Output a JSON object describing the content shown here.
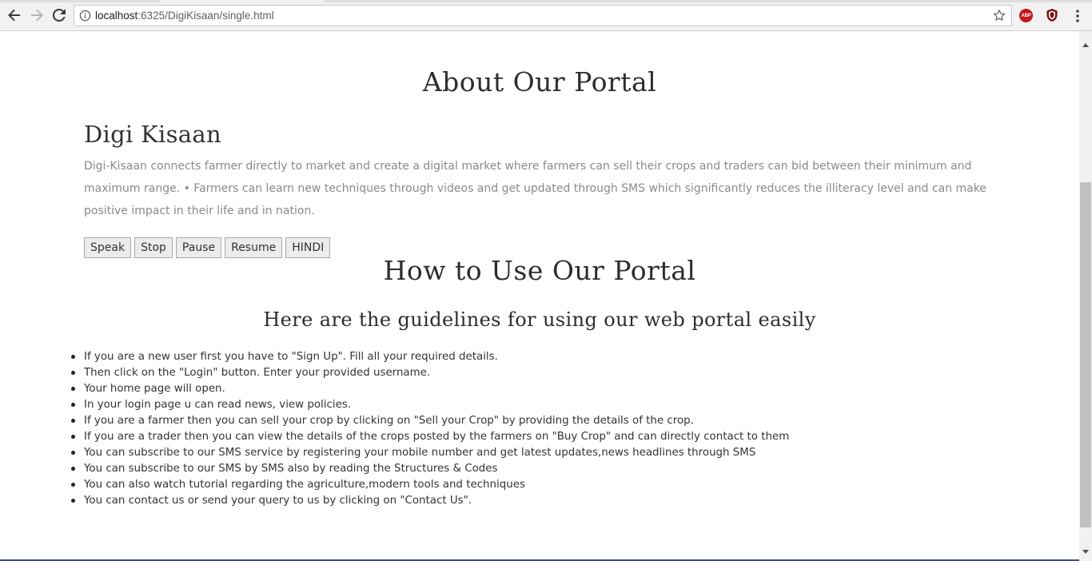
{
  "browser": {
    "url_host": "localhost",
    "url_rest": ":6325/DigiKisaan/single.html",
    "extensions": {
      "abp_label": "ABP"
    }
  },
  "page": {
    "about_title": "About Our Portal",
    "portal_name": "Digi Kisaan",
    "description": "Digi-Kisaan connects farmer directly to market and create a digital market where farmers can sell their crops and traders can bid between their minimum and maximum range. • Farmers can learn new techniques through videos and get updated through SMS which significantly reduces the illiteracy level and can make positive impact in their life and in nation.",
    "speech_buttons": {
      "speak": "Speak",
      "stop": "Stop",
      "pause": "Pause",
      "resume": "Resume",
      "hindi": "HINDI"
    },
    "how_title": "How to Use Our Portal",
    "guidelines_title": "Here are the guidelines for using our web portal easily",
    "guidelines": [
      "If you are a new user first you have to \"Sign Up\". Fill all your required details.",
      "Then click on the \"Login\" button. Enter your provided username.",
      "Your home page will open.",
      "In your login page u can read news, view policies.",
      "If you are a farmer then you can sell your crop by clicking on \"Sell your Crop\" by providing the details of the crop.",
      "If you are a trader then you can view the details of the crops posted by the farmers on \"Buy Crop\" and can directly contact to them",
      "You can subscribe to our SMS service by registering your mobile number and get latest updates,news headlines through SMS",
      "You can subscribe to our SMS by SMS also by reading the Structures & Codes",
      "You can also watch tutorial regarding the agriculture,modern tools and techniques",
      "You can contact us or send your query to us by clicking on \"Contact Us\"."
    ]
  },
  "colors": {
    "heading": "#2d2d2d",
    "description": "#8a8a8a",
    "abp_red": "#c4161c",
    "footer_band": "#3d4f66"
  }
}
